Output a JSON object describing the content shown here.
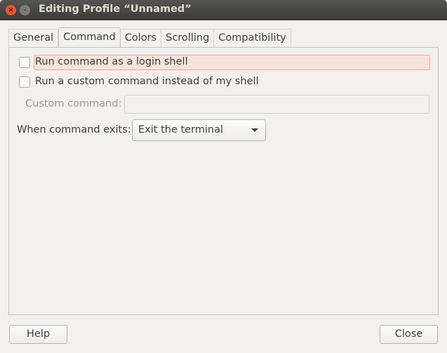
{
  "window": {
    "title": "Editing Profile “Unnamed”"
  },
  "tabs": [
    {
      "label": "General"
    },
    {
      "label": "Command",
      "active": true
    },
    {
      "label": "Colors"
    },
    {
      "label": "Scrolling"
    },
    {
      "label": "Compatibility"
    }
  ],
  "command": {
    "login_shell": {
      "label": "Run command as a login shell",
      "checked": false
    },
    "custom_command": {
      "label": "Run a custom command instead of my shell",
      "checked": false
    },
    "custom_command_field": {
      "label": "Custom command:",
      "value": ""
    },
    "on_exit": {
      "label": "When command exits:",
      "selected": "Exit the terminal"
    }
  },
  "buttons": {
    "help": "Help",
    "close": "Close"
  }
}
